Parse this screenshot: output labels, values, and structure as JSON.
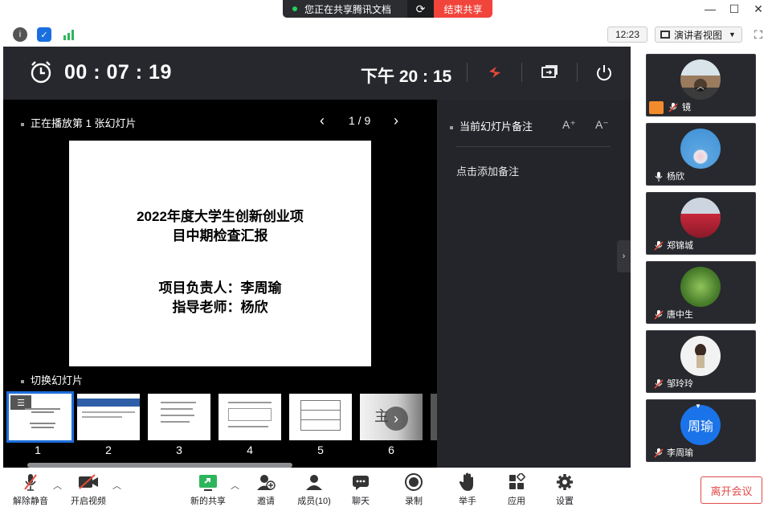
{
  "share_banner": {
    "status_text": "您正在共享腾讯文档",
    "stop_label": "结束共享"
  },
  "topbar": {
    "clock": "12:23",
    "view_label": "演讲者视图"
  },
  "presenter": {
    "elapsed": "00 : 07 : 19",
    "time_of_day": "下午 20 : 15",
    "playing_label": "正在播放第 1 张幻灯片",
    "pager": "1 / 9",
    "notes_label": "当前幻灯片备注",
    "font_up": "A⁺",
    "font_down": "A⁻",
    "add_note": "点击添加备注",
    "switch_label": "切换幻灯片",
    "slide": {
      "title_line1": "2022年度大学生创新创业项",
      "title_line2": "目中期检查汇报",
      "leader": "项目负责人：李周瑜",
      "advisor": "指导老师：杨欣"
    },
    "thumbnails": [
      "1",
      "2",
      "3",
      "4",
      "5",
      "6"
    ]
  },
  "participants": [
    {
      "name": "镜",
      "avatar_color": "#9a7b5e"
    },
    {
      "name": "杨欣",
      "avatar_color": "#3f8fd6"
    },
    {
      "name": "郑锦城",
      "avatar_color": "#c8283a"
    },
    {
      "name": "唐中生",
      "avatar_color": "#4a7f2c"
    },
    {
      "name": "邹玲玲",
      "avatar_color": "#f2f2f2"
    },
    {
      "name": "李周瑜",
      "avatar_text": "周瑜",
      "avatar_color": "#1a73e8"
    }
  ],
  "bottombar": {
    "unmute": "解除静音",
    "video": "开启视频",
    "share": "新的共享",
    "invite": "邀请",
    "members": "成员(10)",
    "chat": "聊天",
    "record": "录制",
    "raise_hand": "举手",
    "apps": "应用",
    "settings": "设置",
    "leave": "离开会议"
  }
}
